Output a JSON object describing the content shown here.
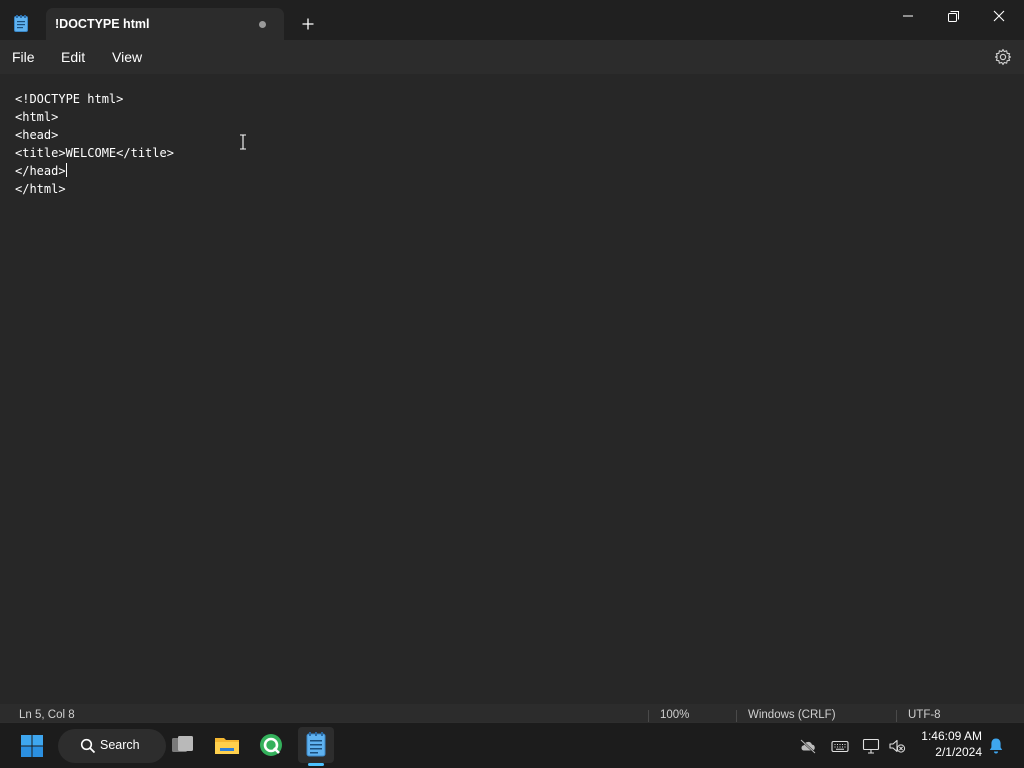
{
  "window": {
    "tab_title": "!DOCTYPE html",
    "tab_unsaved": true
  },
  "menu": {
    "file": "File",
    "edit": "Edit",
    "view": "View"
  },
  "editor": {
    "lines": [
      "<!DOCTYPE html>",
      "<html>",
      "<head>",
      "<title>WELCOME</title>",
      "</head>",
      "</html>"
    ],
    "caret_line": 5,
    "caret_col": 8
  },
  "statusbar": {
    "position": "Ln 5, Col 8",
    "zoom": "100%",
    "line_ending": "Windows (CRLF)",
    "encoding": "UTF-8"
  },
  "taskbar": {
    "search_label": "Search",
    "time": "1:46:09 AM",
    "date": "2/1/2024",
    "active_app": "notepad",
    "apps": [
      "task-view",
      "file-explorer",
      "quick-start",
      "notepad"
    ]
  },
  "colors": {
    "accent": "#4cc2ff",
    "editor_bg": "#272727",
    "titlebar_bg": "#202020",
    "taskbar_bg": "#1c1c1c"
  }
}
